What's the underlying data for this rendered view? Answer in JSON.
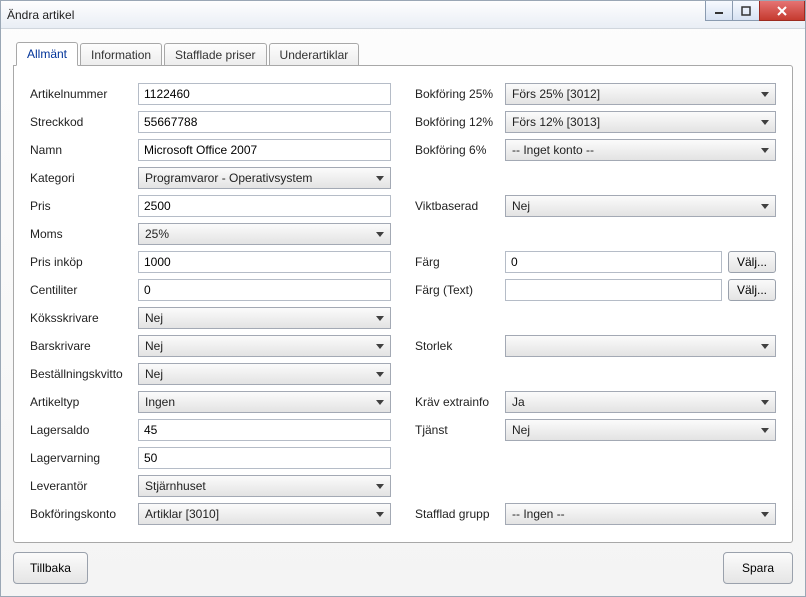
{
  "window": {
    "title": "Ändra artikel"
  },
  "tabs": [
    {
      "label": "Allmänt",
      "active": true
    },
    {
      "label": "Information"
    },
    {
      "label": "Stafflade priser"
    },
    {
      "label": "Underartiklar"
    }
  ],
  "left": {
    "artikelnummer_label": "Artikelnummer",
    "artikelnummer_value": "1122460",
    "streckkod_label": "Streckkod",
    "streckkod_value": "55667788",
    "namn_label": "Namn",
    "namn_value": "Microsoft Office 2007",
    "kategori_label": "Kategori",
    "kategori_value": "Programvaror - Operativsystem",
    "pris_label": "Pris",
    "pris_value": "2500",
    "moms_label": "Moms",
    "moms_value": "25%",
    "prisinkop_label": "Pris inköp",
    "prisinkop_value": "1000",
    "centiliter_label": "Centiliter",
    "centiliter_value": "0",
    "koksskrivare_label": "Köksskrivare",
    "koksskrivare_value": "Nej",
    "barskrivare_label": "Barskrivare",
    "barskrivare_value": "Nej",
    "bestallningskvitto_label": "Beställningskvitto",
    "bestallningskvitto_value": "Nej",
    "artikeltyp_label": "Artikeltyp",
    "artikeltyp_value": "Ingen",
    "lagersaldo_label": "Lagersaldo",
    "lagersaldo_value": "45",
    "lagervarning_label": "Lagervarning",
    "lagervarning_value": "50",
    "leverantor_label": "Leverantör",
    "leverantor_value": "Stjärnhuset",
    "bokforingskonto_label": "Bokföringskonto",
    "bokforingskonto_value": "Artiklar [3010]"
  },
  "right": {
    "bokforing25_label": "Bokföring 25%",
    "bokforing25_value": "Förs 25% [3012]",
    "bokforing12_label": "Bokföring 12%",
    "bokforing12_value": "Förs 12% [3013]",
    "bokforing6_label": "Bokföring 6%",
    "bokforing6_value": "-- Inget konto --",
    "viktbaserad_label": "Viktbaserad",
    "viktbaserad_value": "Nej",
    "farg_label": "Färg",
    "farg_value": "0",
    "fargtext_label": "Färg (Text)",
    "fargtext_value": "",
    "valj_label": "Välj...",
    "storlek_label": "Storlek",
    "storlek_value": "",
    "krav_extrainfo_label": "Kräv extrainfo",
    "krav_extrainfo_value": "Ja",
    "tjanst_label": "Tjänst",
    "tjanst_value": "Nej",
    "stafflad_grupp_label": "Stafflad grupp",
    "stafflad_grupp_value": "-- Ingen --"
  },
  "buttons": {
    "back": "Tillbaka",
    "save": "Spara"
  }
}
